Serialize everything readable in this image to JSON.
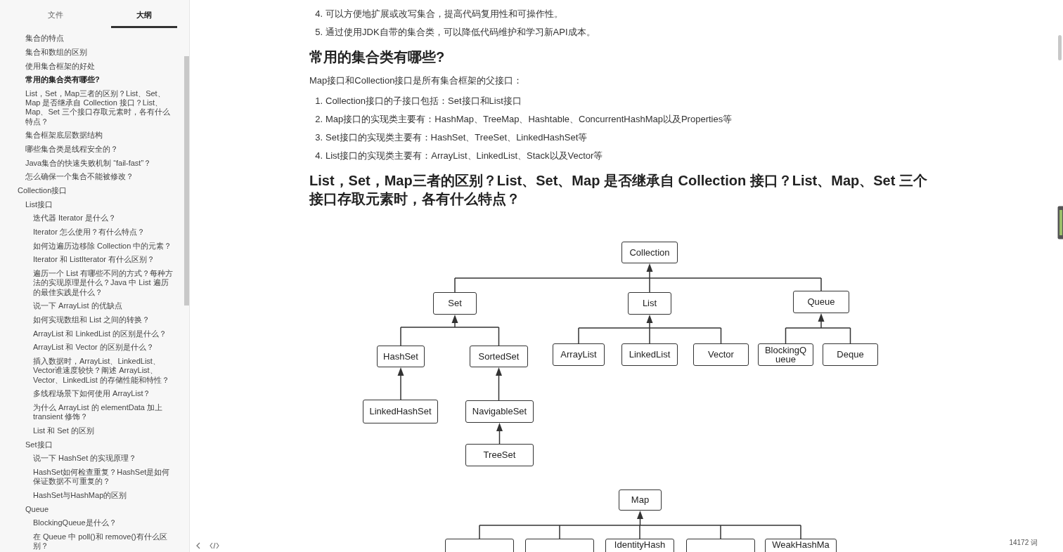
{
  "sidebar": {
    "tabs": [
      {
        "label": "文件",
        "selected": false
      },
      {
        "label": "大纲",
        "selected": true
      }
    ],
    "outline": [
      {
        "children": [
          {
            "label": "集合的特点",
            "selected": false
          },
          {
            "label": "集合和数组的区别",
            "selected": false
          },
          {
            "label": "使用集合框架的好处",
            "selected": false
          },
          {
            "label": "常用的集合类有哪些?",
            "selected": true
          },
          {
            "label": "List，Set，Map三者的区别？List、Set、Map 是否继承自 Collection 接口？List、Map、Set 三个接口存取元素时，各有什么特点？",
            "selected": false
          },
          {
            "label": "集合框架底层数据结构",
            "selected": false
          },
          {
            "label": "哪些集合类是线程安全的？",
            "selected": false
          },
          {
            "label": "Java集合的快速失败机制 “fail-fast”？",
            "selected": false
          },
          {
            "label": "怎么确保一个集合不能被修改？",
            "selected": false
          }
        ]
      },
      {
        "label": "Collection接口",
        "selected": false,
        "children": [
          {
            "label": "List接口",
            "selected": false,
            "children": [
              {
                "label": "迭代器 Iterator 是什么？",
                "selected": false
              },
              {
                "label": "Iterator 怎么使用？有什么特点？",
                "selected": false
              },
              {
                "label": "如何边遍历边移除 Collection 中的元素？",
                "selected": false
              },
              {
                "label": "Iterator 和 ListIterator 有什么区别？",
                "selected": false
              },
              {
                "label": "遍历一个 List 有哪些不同的方式？每种方法的实现原理是什么？Java 中 List 遍历的最佳实践是什么？",
                "selected": false
              },
              {
                "label": "说一下 ArrayList 的优缺点",
                "selected": false
              },
              {
                "label": "如何实现数组和 List 之间的转换？",
                "selected": false
              },
              {
                "label": "ArrayList 和 LinkedList 的区别是什么？",
                "selected": false
              },
              {
                "label": "ArrayList 和 Vector 的区别是什么？",
                "selected": false
              },
              {
                "label": "插入数据时，ArrayList、LinkedList、Vector谁速度较快？阐述 ArrayList、Vector、LinkedList 的存储性能和特性？",
                "selected": false
              },
              {
                "label": "多线程场景下如何使用 ArrayList？",
                "selected": false
              },
              {
                "label": "为什么 ArrayList 的 elementData 加上 transient 修饰？",
                "selected": false
              },
              {
                "label": "List 和 Set 的区别",
                "selected": false
              }
            ]
          },
          {
            "label": "Set接口",
            "selected": false,
            "children": [
              {
                "label": "说一下 HashSet 的实现原理？",
                "selected": false
              },
              {
                "label": "HashSet如何检查重复？HashSet是如何保证数据不可重复的？",
                "selected": false
              },
              {
                "label": "HashSet与HashMap的区别",
                "selected": false
              }
            ]
          },
          {
            "label": "Queue",
            "selected": false,
            "children": [
              {
                "label": "BlockingQueue是什么？",
                "selected": false
              },
              {
                "label": "在 Queue 中 poll()和 remove()有什么区别？",
                "selected": false
              }
            ]
          }
        ]
      }
    ]
  },
  "document": {
    "blocks": [
      {
        "kind": "list_item",
        "number": "4.",
        "text": "可以方便地扩展或改写集合，提高代码复用性和可操作性。"
      },
      {
        "kind": "list_item",
        "number": "5.",
        "text": "通过使用JDK自带的集合类，可以降低代码维护和学习新API成本。"
      },
      {
        "kind": "heading",
        "text": "常用的集合类有哪些?"
      },
      {
        "kind": "paragraph",
        "text": "Map接口和Collection接口是所有集合框架的父接口："
      },
      {
        "kind": "list_item",
        "number": "1.",
        "text": "Collection接口的子接口包括：Set接口和List接口"
      },
      {
        "kind": "list_item",
        "number": "2.",
        "text": "Map接口的实现类主要有：HashMap、TreeMap、Hashtable、ConcurrentHashMap以及Properties等"
      },
      {
        "kind": "list_item",
        "number": "3.",
        "text": "Set接口的实现类主要有：HashSet、TreeSet、LinkedHashSet等"
      },
      {
        "kind": "list_item",
        "number": "4.",
        "text": "List接口的实现类主要有：ArrayList、LinkedList、Stack以及Vector等"
      },
      {
        "kind": "heading",
        "text": "List，Set，Map三者的区别？List、Set、Map 是否继承自 Collection 接口？List、Map、Set 三个接口存取元素时，各有什么特点？"
      },
      {
        "kind": "diagram",
        "nodes": [
          {
            "kind": "named",
            "label": "Collection"
          },
          {
            "kind": "named",
            "label": "Set"
          },
          {
            "kind": "named",
            "label": "List"
          },
          {
            "kind": "named",
            "label": "Queue"
          },
          {
            "kind": "named",
            "label": "HashSet"
          },
          {
            "kind": "named",
            "label": "SortedSet"
          },
          {
            "kind": "named",
            "label": "ArrayList"
          },
          {
            "kind": "named",
            "label": "LinkedList"
          },
          {
            "kind": "named",
            "label": "Vector"
          },
          {
            "kind": "named",
            "label": "BlockingQueue"
          },
          {
            "kind": "named",
            "label": "Deque"
          },
          {
            "kind": "named",
            "label": "LinkedHashSet"
          },
          {
            "kind": "named",
            "label": "NavigableSet"
          },
          {
            "kind": "named",
            "label": "TreeSet"
          },
          {
            "kind": "named",
            "label": "Map"
          },
          {
            "kind": "cut"
          },
          {
            "kind": "cut"
          },
          {
            "kind": "named",
            "label": "IdentityHash"
          },
          {
            "kind": "cut"
          },
          {
            "kind": "named",
            "label": "WeakHashMa"
          }
        ]
      }
    ]
  },
  "status_bar": {
    "word_count": "14172 词"
  }
}
